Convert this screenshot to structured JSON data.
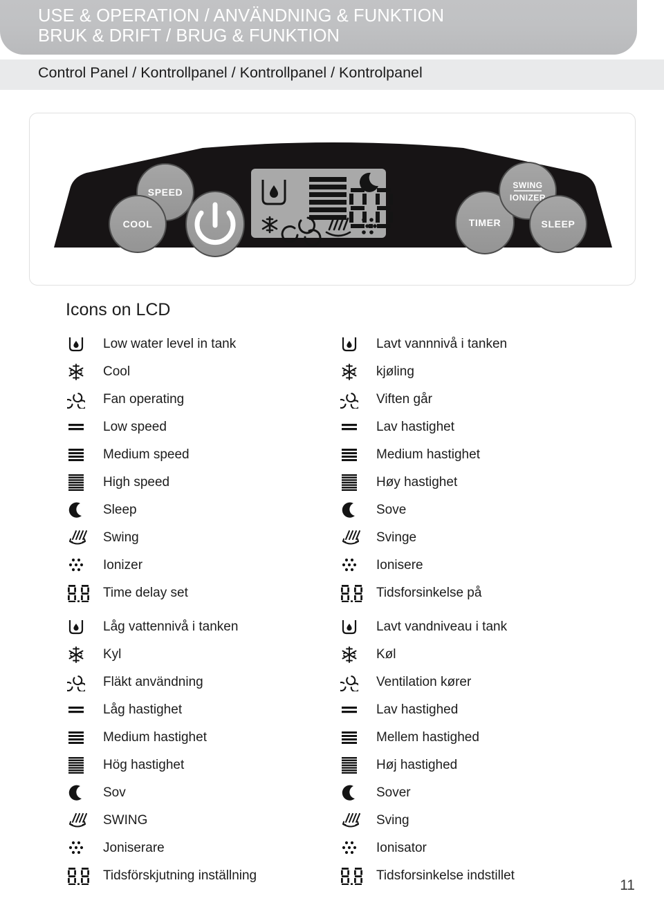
{
  "header": {
    "line1": "USE & OPERATION / ANVÄNDNING & FUNKTION",
    "line2": "BRUK & DRIFT / BRUG & FUNKTION",
    "background_color": "#c0c1c3",
    "text_color": "#ffffff"
  },
  "subtitle": {
    "text": "Control Panel / Kontrollpanel / Kontrollpanel / Kontrolpanel",
    "band_color": "#e9eaeb"
  },
  "control_panel": {
    "body_color": "#1a1718",
    "button_color": "#9b9b9b",
    "lcd_color": "#a8a8a8",
    "buttons": [
      {
        "label": "SPEED",
        "name": "speed-button"
      },
      {
        "label": "COOL",
        "name": "cool-button"
      },
      {
        "label": "",
        "name": "power-button"
      },
      {
        "label": "TIMER",
        "name": "timer-button"
      },
      {
        "label": "SWING",
        "name": "swing-button"
      },
      {
        "label": "IONIZER",
        "name": "ionizer-button"
      },
      {
        "label": "SLEEP",
        "name": "sleep-button"
      }
    ],
    "lcd": {
      "digits": "8.8",
      "indicators": [
        "low-water-tank",
        "fan-speed-bars",
        "moon",
        "snowflake",
        "fan",
        "swing",
        "ionizer"
      ]
    }
  },
  "section_heading": "Icons on LCD",
  "legend": {
    "english": [
      {
        "icon": "low-water-tank-icon",
        "label": "Low water level in tank"
      },
      {
        "icon": "snowflake-icon",
        "label": "Cool"
      },
      {
        "icon": "fan-icon",
        "label": "Fan operating"
      },
      {
        "icon": "low-speed-icon",
        "label": "Low speed"
      },
      {
        "icon": "medium-speed-icon",
        "label": "Medium speed"
      },
      {
        "icon": "high-speed-icon",
        "label": "High speed"
      },
      {
        "icon": "moon-icon",
        "label": "Sleep"
      },
      {
        "icon": "swing-icon",
        "label": "Swing"
      },
      {
        "icon": "ionizer-icon",
        "label": "Ionizer"
      },
      {
        "icon": "seven-segment-icon",
        "label": "Time delay set"
      }
    ],
    "norwegian": [
      {
        "icon": "low-water-tank-icon",
        "label": "Lavt vannnivå i tanken"
      },
      {
        "icon": "snowflake-icon",
        "label": "kjøling"
      },
      {
        "icon": "fan-icon",
        "label": "Viften går"
      },
      {
        "icon": "low-speed-icon",
        "label": "Lav hastighet"
      },
      {
        "icon": "medium-speed-icon",
        "label": "Medium hastighet"
      },
      {
        "icon": "high-speed-icon",
        "label": "Høy hastighet"
      },
      {
        "icon": "moon-icon",
        "label": "Sove"
      },
      {
        "icon": "swing-icon",
        "label": "Svinge"
      },
      {
        "icon": "ionizer-icon",
        "label": "Ionisere"
      },
      {
        "icon": "seven-segment-icon",
        "label": "Tidsforsinkelse på"
      }
    ],
    "swedish": [
      {
        "icon": "low-water-tank-icon",
        "label": "Låg vattennivå i tanken"
      },
      {
        "icon": "snowflake-icon",
        "label": "Kyl"
      },
      {
        "icon": "fan-icon",
        "label": "Fläkt användning"
      },
      {
        "icon": "low-speed-icon",
        "label": "Låg hastighet"
      },
      {
        "icon": "medium-speed-icon",
        "label": "Medium hastighet"
      },
      {
        "icon": "high-speed-icon",
        "label": "Hög hastighet"
      },
      {
        "icon": "moon-icon",
        "label": "Sov"
      },
      {
        "icon": "swing-icon",
        "label": "SWING"
      },
      {
        "icon": "ionizer-icon",
        "label": "Joniserare"
      },
      {
        "icon": "seven-segment-icon",
        "label": "Tidsförskjutning inställning"
      }
    ],
    "danish": [
      {
        "icon": "low-water-tank-icon",
        "label": "Lavt vandniveau i tank"
      },
      {
        "icon": "snowflake-icon",
        "label": "Køl"
      },
      {
        "icon": "fan-icon",
        "label": "Ventilation kører"
      },
      {
        "icon": "low-speed-icon",
        "label": "Lav hastighed"
      },
      {
        "icon": "medium-speed-icon",
        "label": "Mellem hastighed"
      },
      {
        "icon": "high-speed-icon",
        "label": "Høj hastighed"
      },
      {
        "icon": "moon-icon",
        "label": "Sover"
      },
      {
        "icon": "swing-icon",
        "label": "Sving"
      },
      {
        "icon": "ionizer-icon",
        "label": "Ionisator"
      },
      {
        "icon": "seven-segment-icon",
        "label": "Tidsforsinkelse indstillet"
      }
    ]
  },
  "page_number": "11"
}
